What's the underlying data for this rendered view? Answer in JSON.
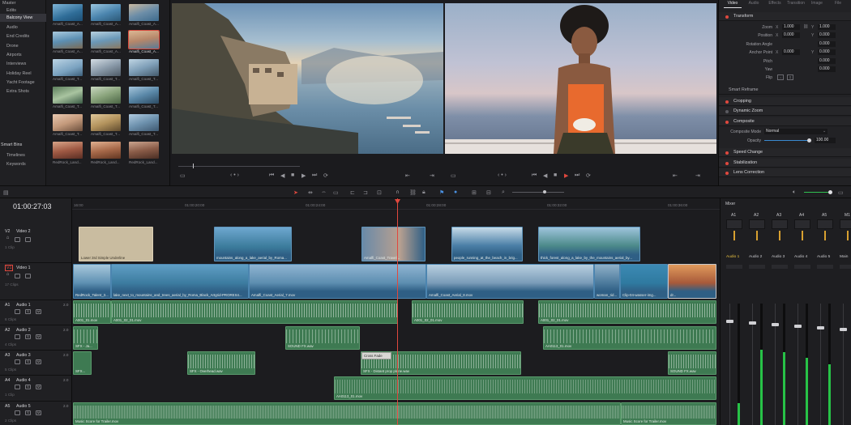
{
  "bins": {
    "items": [
      "Master",
      "Edits",
      "Balcony View",
      "Audio",
      "End Credits",
      "Drone",
      "Airports",
      "Interviews",
      "Holiday Reel",
      "Yacht Footage",
      "Extra Shots"
    ],
    "smart_title": "Smart Bins",
    "smart_items": [
      "Timelines",
      "Keywords"
    ]
  },
  "thumbs": {
    "labels": [
      "Amalfi_Coast_A...",
      "Amalfi_Coast_A...",
      "Amalfi_Coast_A...",
      "Amalfi_Coast_A...",
      "Amalfi_Coast_A...",
      "Amalfi_Coast_A...",
      "Amalfi_Coast_T...",
      "Amalfi_Coast_T...",
      "Amalfi_Coast_T...",
      "Amalfi_Coast_T...",
      "Amalfi_Coast_T...",
      "Amalfi_Coast_T...",
      "Amalfi_Coast_T...",
      "Amalfi_Coast_T...",
      "Amalfi_Coast_T...",
      "RedRock_Land...",
      "RedRock_Land...",
      "RedRock_Land..."
    ]
  },
  "inspector": {
    "tabs": [
      "Video",
      "Audio",
      "Effects",
      "Transition",
      "Image",
      "File"
    ],
    "transform": "Transform",
    "zoom_label": "Zoom",
    "zoom_x": "1.000",
    "zoom_y": "1.000",
    "position_label": "Position",
    "pos_x": "0.000",
    "pos_y": "0.000",
    "rotation_label": "Rotation Angle",
    "rotation": "0.000",
    "anchor_label": "Anchor Point",
    "anchor_x": "0.000",
    "anchor_y": "0.000",
    "pitch_label": "Pitch",
    "pitch": "0.000",
    "yaw_label": "Yaw",
    "yaw": "0.000",
    "flip_label": "Flip",
    "smart_reframe": "Smart Reframe",
    "cropping": "Cropping",
    "dynamic_zoom": "Dynamic Zoom",
    "composite": "Composite",
    "composite_mode_label": "Composite Mode",
    "composite_mode": "Normal",
    "opacity_label": "Opacity",
    "opacity": "100.00",
    "speed_change": "Speed Change",
    "stabilization": "Stabilization",
    "lens_correction": "Lens Correction",
    "x": "X",
    "y": "Y"
  },
  "timeline": {
    "timecode": "01:00:27:03",
    "ruler": [
      "16:00",
      "01:00:20:00",
      "01:00:24:00",
      "01:00:28:00",
      "01:00:32:00",
      "01:00:36:00"
    ],
    "tracks": [
      {
        "id": "V2",
        "name": "Video 2",
        "clips": "1 Clip"
      },
      {
        "id": "V1",
        "name": "Video 1",
        "clips": "17 Clips"
      },
      {
        "id": "A1",
        "name": "Audio 1",
        "vol": "2.0",
        "clips": "6 Clips"
      },
      {
        "id": "A2",
        "name": "Audio 2",
        "vol": "2.0",
        "clips": "4 Clips"
      },
      {
        "id": "A3",
        "name": "Audio 3",
        "vol": "2.0",
        "clips": "5 Clips"
      },
      {
        "id": "A4",
        "name": "Audio 4",
        "vol": "2.0",
        "clips": "1 Clip"
      },
      {
        "id": "A5",
        "name": "Audio 5",
        "vol": "2.0",
        "clips": "2 Clips"
      }
    ],
    "v2_clips": [
      "Lower 3rd Simple Underline",
      "mountains_along_a_lake_aerial_by_Roma...",
      "Amalfi_Coast_Travel...",
      "people_running_at_the_beach_in_brig...",
      "thick_forest_along_a_lake_by_the_mountains_aerial_by..."
    ],
    "v1_clips": [
      "RedRock_Talent_3...",
      "lake_next_to_mountains_and_trees_aerial_by_Roma_Black_Artgrid-PRORES4...",
      "Amalfi_Coast_Aerial_7.mov",
      "Amalfi_Coast_Aerial_8.mov",
      "woman_rid...",
      "Clip-04-wasser-img...",
      "dr..."
    ],
    "a1_clips": [
      "A001_01.mov",
      "A001_02_01.mov",
      "A001_02_01.mov",
      "A001_02_01.mov"
    ],
    "a2_clips": [
      "SFX - Ja...",
      "SOUND FX.wav",
      "AA0113_01.mov"
    ],
    "a3_clips": [
      "SFX...",
      "SFX - Overhead.wav",
      "Cross Fade",
      "SFX - Distant prop plane.wav",
      "SOUND FX.wav"
    ],
    "a4_clips": [
      "AA0113_01.mov"
    ],
    "a5_clips": [
      "Music Score for Trailer.mov",
      "Music Score for Trailer.mov"
    ]
  },
  "mixer": {
    "title": "Mixer",
    "channels": [
      "A1",
      "A2",
      "A3",
      "A4",
      "A5",
      "M1"
    ],
    "names": [
      "Audio 1",
      "Audio 2",
      "Audio 3",
      "Audio 4",
      "Audio 5",
      "Main"
    ],
    "levels": [
      0.18,
      0.62,
      0.6,
      0.55,
      0.5,
      0.72
    ]
  }
}
